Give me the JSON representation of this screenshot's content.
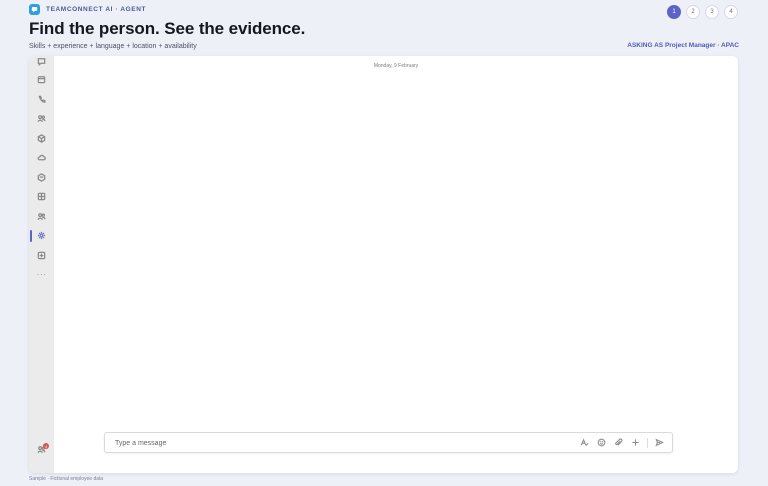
{
  "header": {
    "brand": "TEAMCONNECT AI · AGENT",
    "headline": "Find the person. See the evidence.",
    "subline": "Skills + experience + language + location + availability",
    "context": "ASKING AS Project Manager · APAC"
  },
  "steps": [
    {
      "label": "1",
      "active": true
    },
    {
      "label": "2",
      "active": false
    },
    {
      "label": "3",
      "active": false
    },
    {
      "label": "4",
      "active": false
    }
  ],
  "rail": {
    "items": [
      "chat-icon",
      "calendar-icon",
      "phone-icon",
      "people-icon",
      "app-cube-icon",
      "cloud-icon",
      "app-box-icon",
      "grid-icon",
      "teams-icon",
      "agent-gear-icon",
      "add-app-icon",
      "more-icon"
    ],
    "active_item": "agent-gear-icon",
    "more_label": "···",
    "bottom_badge": "4"
  },
  "chat": {
    "date_divider": "Monday, 9 February"
  },
  "composer": {
    "placeholder": "Type a message",
    "value": ""
  },
  "footnote": "Sample · Fictional employee data",
  "colors": {
    "accent": "#5b63c7",
    "brand": "#2f9fd9",
    "background": "#eef0f8"
  }
}
